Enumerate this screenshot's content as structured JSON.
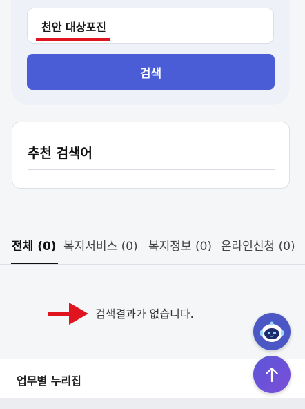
{
  "search": {
    "value": "천안 대상포진",
    "button_label": "검색"
  },
  "recommended": {
    "title": "추천 검색어"
  },
  "tabs": [
    {
      "label": "전체 (0)",
      "active": true
    },
    {
      "label": "복지서비스 (0)",
      "active": false
    },
    {
      "label": "복지정보 (0)",
      "active": false
    },
    {
      "label": "온라인신청 (0)",
      "active": false
    }
  ],
  "results": {
    "empty_message": "검색결과가 없습니다."
  },
  "bottom": {
    "title": "업무별 누리집"
  },
  "colors": {
    "accent": "#4a5dd6",
    "highlight_red": "#e0141e",
    "top_button": "#6a52d8"
  },
  "icons": {
    "chatbot": "chatbot-icon",
    "scroll_top": "arrow-up-icon",
    "annotation": "red-arrow-icon"
  }
}
